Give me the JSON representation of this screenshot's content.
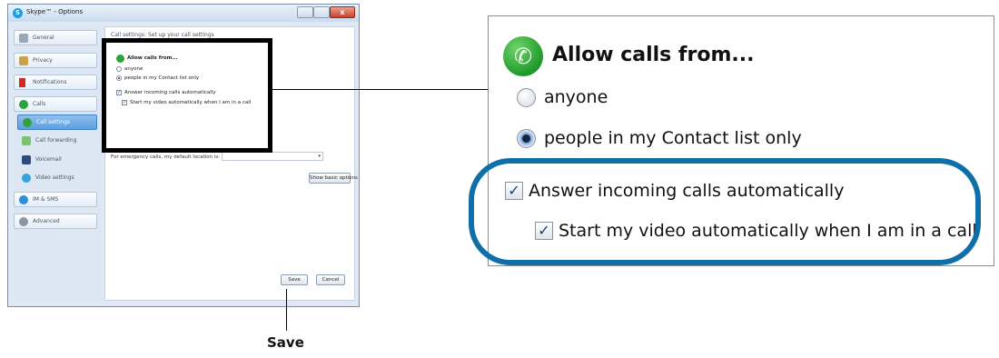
{
  "window": {
    "title": "Skype™ - Options",
    "close_label": "x"
  },
  "sidebar": {
    "items": [
      {
        "label": "General",
        "icon": "general-icon"
      },
      {
        "label": "Privacy",
        "icon": "privacy-icon"
      },
      {
        "label": "Notifications",
        "icon": "flag-icon"
      },
      {
        "label": "Calls",
        "icon": "phone-icon"
      },
      {
        "label": "Call settings",
        "icon": "phone-icon"
      },
      {
        "label": "Call forwarding",
        "icon": "forward-icon"
      },
      {
        "label": "Voicemail",
        "icon": "voicemail-icon"
      },
      {
        "label": "Video settings",
        "icon": "video-icon"
      },
      {
        "label": "IM & SMS",
        "icon": "chat-icon"
      },
      {
        "label": "Advanced",
        "icon": "gear-icon"
      }
    ]
  },
  "panel": {
    "header": "Call settings: Set up your call settings",
    "allow_calls_title": "Allow calls from...",
    "option_anyone": "anyone",
    "option_contacts": "people in my Contact list only",
    "answer_auto": "Answer incoming calls automatically",
    "start_video": "Start my video automatically when I am in a call",
    "emergency_label": "For emergency calls, my default location is:",
    "emergency_value": "▾",
    "show_basic_button": "Show basic options",
    "save_button": "Save",
    "cancel_button": "Cancel"
  },
  "caption": {
    "save": "Save"
  },
  "zoom": {
    "title": "Allow calls from...",
    "option_anyone": "anyone",
    "option_contacts": "people in my Contact list only",
    "answer_auto": "Answer incoming calls automatically",
    "start_video": "Start my video automatically when I am in a call",
    "selected_option": "people in my Contact list only",
    "answer_auto_checked": true,
    "start_video_checked": true,
    "highlight_color": "#0f6fa9"
  }
}
